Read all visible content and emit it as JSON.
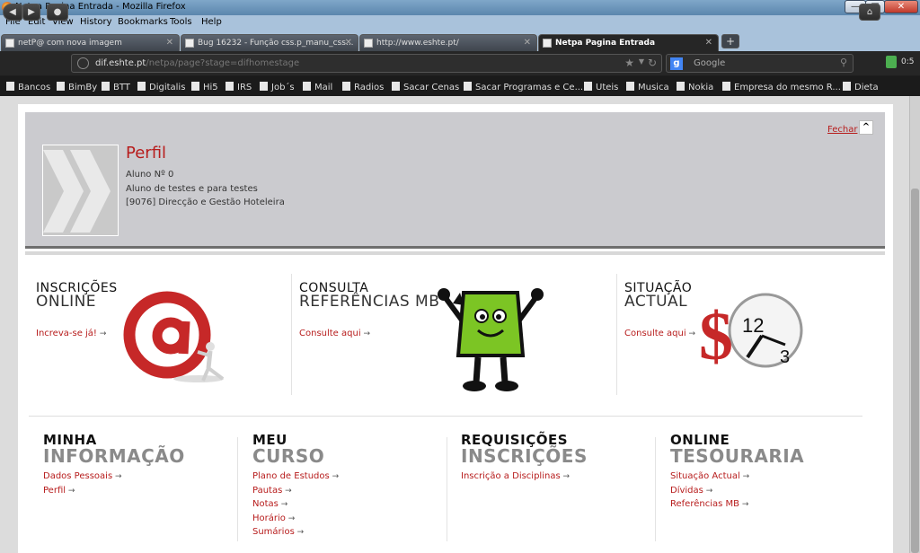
{
  "window": {
    "title": "Netpa Pagina Entrada - Mozilla Firefox"
  },
  "menu": [
    "File",
    "Edit",
    "View",
    "History",
    "Bookmarks",
    "Tools",
    "Help"
  ],
  "tabs": [
    {
      "label": "netP@ com nova imagem"
    },
    {
      "label": "Bug 16232 - Função css.p_manu_css..."
    },
    {
      "label": "http://www.eshte.pt/"
    },
    {
      "label": "Netpa Pagina Entrada"
    }
  ],
  "nav": {
    "url_domain": "dif.eshte.pt",
    "url_path": "/netpa/page?stage=difhomestage",
    "search_placeholder": "Google",
    "addon_count": "0:5"
  },
  "bookmarks": [
    "Bancos",
    "BimBy",
    "BTT",
    "Digitalis",
    "Hi5",
    "IRS",
    "Job´s",
    "Mail",
    "Radios",
    "Sacar Cenas",
    "Sacar Programas e Ce...",
    "Uteis",
    "Musica",
    "Nokia",
    "Empresa do mesmo R...",
    "Dieta"
  ],
  "profile": {
    "title": "Perfil",
    "line1": "Aluno Nº 0",
    "line2": "Aluno de testes e para testes",
    "line3": "[9076] Direcção e Gestão Hoteleira",
    "close_label": "Fechar",
    "close_icon": "chevron-up-icon"
  },
  "features": [
    {
      "small": "INSCRIÇÕES",
      "big": "ONLINE",
      "link": "Increva-se já!",
      "icon": "at-sign-icon"
    },
    {
      "small": "CONSULTA",
      "big": "REFERÊNCIAS MB",
      "link": "Consulte aqui",
      "icon": "mascot-icon"
    },
    {
      "small": "SITUAÇÃO",
      "big": "ACTUAL",
      "link": "Consulte aqui",
      "icon": "dollar-clock-icon"
    }
  ],
  "sections": [
    {
      "small": "MINHA",
      "big": "INFORMAÇÃO",
      "links": [
        "Dados Pessoais",
        "Perfil"
      ]
    },
    {
      "small": "MEU",
      "big": "CURSO",
      "links": [
        "Plano de Estudos",
        "Pautas",
        "Notas",
        "Horário",
        "Sumários"
      ]
    },
    {
      "small": "REQUISIÇÕES",
      "big": "INSCRIÇÕES",
      "links": [
        "Inscrição a Disciplinas"
      ]
    },
    {
      "small": "ONLINE",
      "big": "TESOURARIA",
      "links": [
        "Situação Actual",
        "Dívidas",
        "Referências MB"
      ]
    }
  ],
  "colors": {
    "accent": "#b71c1c",
    "profile_bg": "#cbcbcf",
    "mascot": "#7cc524"
  }
}
